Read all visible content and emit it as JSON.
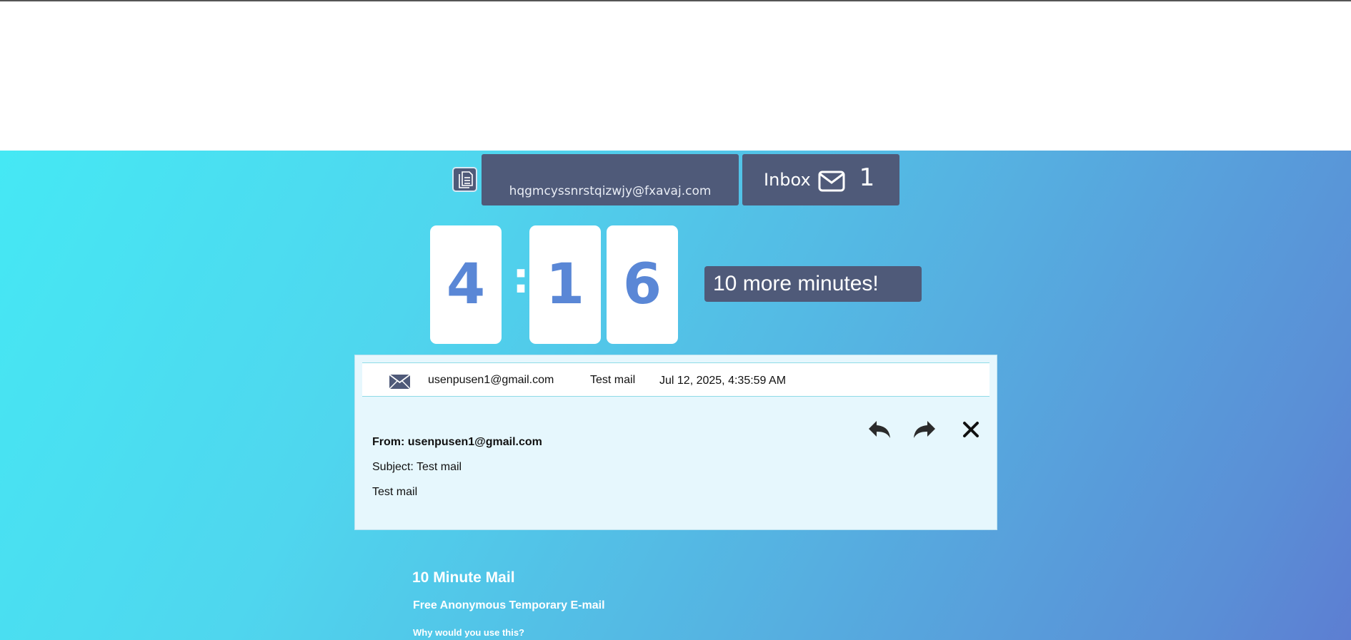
{
  "email_address": "hqgmcyssnrstqizwjy@fxavaj.com",
  "inbox": {
    "label": "Inbox",
    "count": "1"
  },
  "timer": {
    "minutes": "4",
    "separator": ":",
    "seconds_tens": "1",
    "seconds_ones": "6"
  },
  "more_minutes_label": "10 more minutes!",
  "messages": [
    {
      "from": "usenpusen1@gmail.com",
      "subject": "Test mail",
      "date": "Jul 12, 2025, 4:35:59 AM"
    }
  ],
  "open_message": {
    "from_line": "From: usenpusen1@gmail.com",
    "subject_line": "Subject: Test mail",
    "body": "Test mail"
  },
  "footer": {
    "title": "10 Minute Mail",
    "subtitle": "Free Anonymous Temporary E-mail",
    "question": "Why would you use this?"
  },
  "colors": {
    "panel": "#4f5a79",
    "digit": "#5a87d6",
    "accent": "#45e8f4"
  },
  "icons": [
    "copy-icon",
    "envelope-icon",
    "reply-icon",
    "forward-icon",
    "close-icon"
  ]
}
